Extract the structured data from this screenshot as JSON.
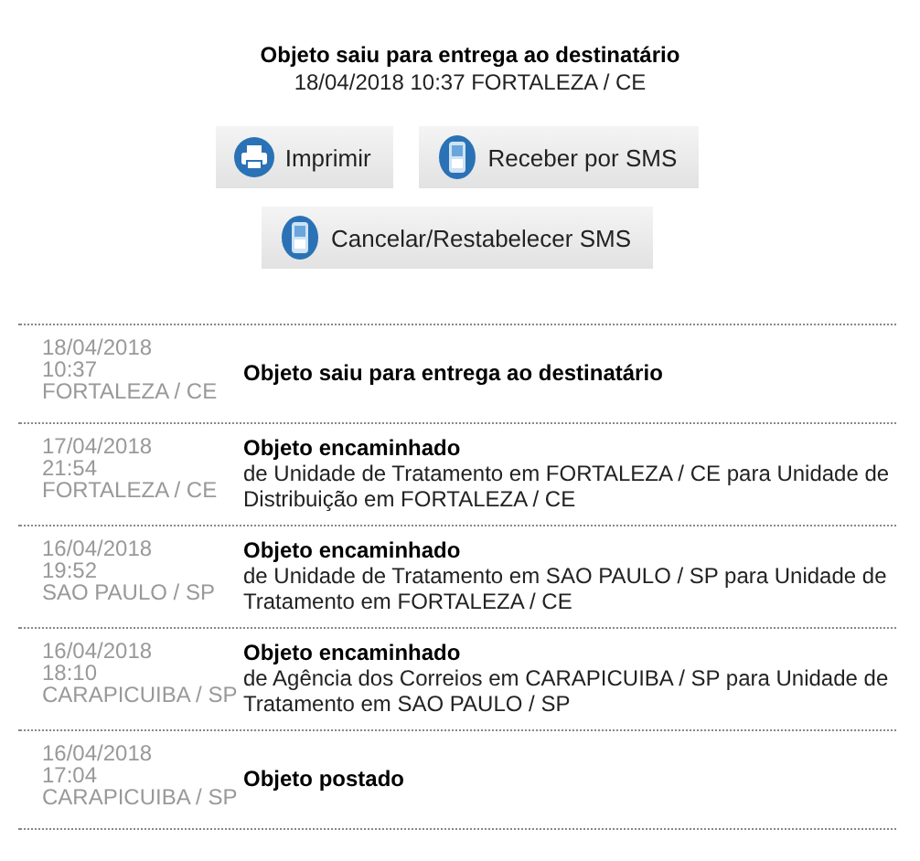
{
  "summary": {
    "status": "Objeto saiu para entrega ao destinatário",
    "detail": "18/04/2018 10:37 FORTALEZA / CE"
  },
  "button_rows": [
    [
      {
        "label": "Imprimir",
        "kind": "printer"
      },
      {
        "label": "Receber por SMS",
        "kind": "phone"
      }
    ],
    [
      {
        "label": "Cancelar/Restabelecer SMS",
        "kind": "phone"
      }
    ]
  ],
  "events": [
    {
      "date": "18/04/2018",
      "time": "10:37",
      "location": "FORTALEZA / CE",
      "title": "Objeto saiu para entrega ao destinatário"
    },
    {
      "date": "17/04/2018",
      "time": "21:54",
      "location": "FORTALEZA / CE",
      "title": "Objeto encaminhado",
      "detail": "de Unidade de Tratamento em FORTALEZA / CE para Unidade de Distribuição em FORTALEZA / CE"
    },
    {
      "date": "16/04/2018",
      "time": "19:52",
      "location": "SAO PAULO / SP",
      "title": "Objeto encaminhado",
      "detail": "de Unidade de Tratamento em SAO PAULO / SP para Unidade de Tratamento em FORTALEZA / CE"
    },
    {
      "date": "16/04/2018",
      "time": "18:10",
      "location": "CARAPICUIBA / SP",
      "title": "Objeto encaminhado",
      "detail": "de Agência dos Correios em CARAPICUIBA / SP para Unidade de Tratamento em SAO PAULO / SP"
    },
    {
      "date": "16/04/2018",
      "time": "17:04",
      "location": "CARAPICUIBA / SP",
      "title": "Objeto postado"
    }
  ]
}
